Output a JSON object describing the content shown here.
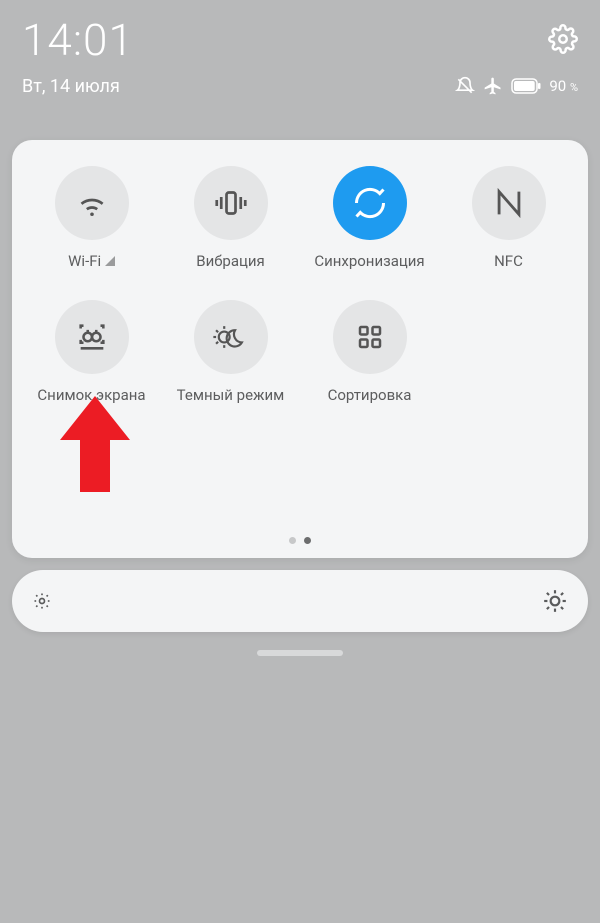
{
  "status": {
    "time": "14:01",
    "date": "Вт, 14 июля",
    "battery_pct": "90",
    "battery_suffix": "%"
  },
  "tiles": {
    "wifi": "Wi-Fi",
    "vibration": "Вибрация",
    "sync": "Синхронизация",
    "nfc": "NFC",
    "screenshot": "Снимок экрана",
    "dark": "Темный режим",
    "sort": "Сортировка"
  }
}
